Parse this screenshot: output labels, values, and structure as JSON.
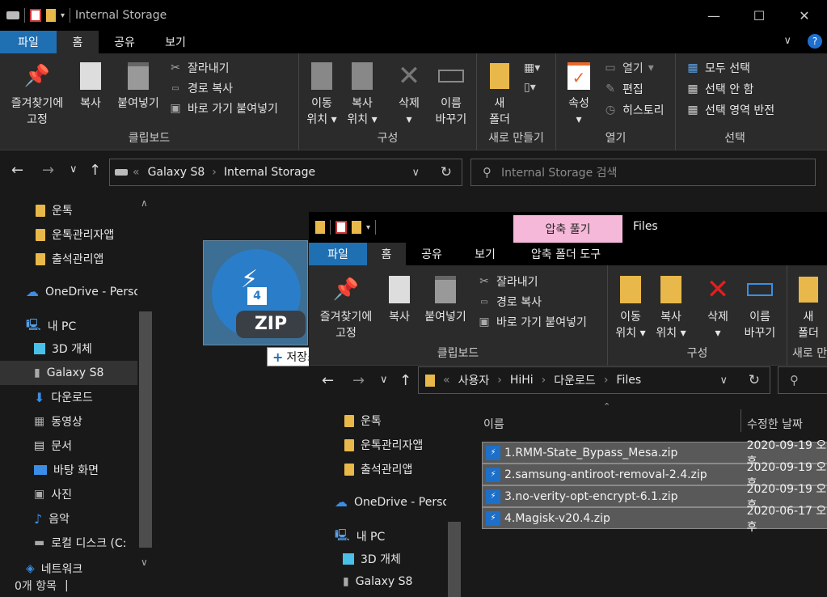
{
  "back_window": {
    "title": "Internal Storage",
    "tabs": [
      "파일",
      "홈",
      "공유",
      "보기"
    ],
    "ribbon": {
      "pin_label": [
        "즐겨찾기에",
        "고정"
      ],
      "copy": "복사",
      "paste": "붙여넣기",
      "cut": "잘라내기",
      "copy_path": "경로 복사",
      "paste_shortcut": "바로 가기 붙여넣기",
      "clipboard_group": "클립보드",
      "move_to": [
        "이동",
        "위치"
      ],
      "copy_to": [
        "복사",
        "위치"
      ],
      "delete": "삭제",
      "rename": [
        "이름",
        "바꾸기"
      ],
      "organize_group": "구성",
      "new_folder": [
        "새",
        "폴더"
      ],
      "new_group": "새로 만들기",
      "properties": "속성",
      "open": "열기",
      "edit": "편집",
      "history": "히스토리",
      "open_group": "열기",
      "select_all": "모두 선택",
      "select_none": "선택 안 함",
      "invert_selection": "선택 영역 반전",
      "select_group": "선택"
    },
    "address": [
      "Galaxy S8",
      "Internal Storage"
    ],
    "search_placeholder": "Internal Storage 검색",
    "nav_items": [
      "운톡",
      "운톡관리자앱",
      "출석관리앱",
      "OneDrive - Perso",
      "내 PC",
      "3D 개체",
      "Galaxy S8",
      "다운로드",
      "동영상",
      "문서",
      "바탕 화면",
      "사진",
      "음악",
      "로컬 디스크 (C:",
      "네트워크"
    ],
    "status": "0개 항목"
  },
  "drag": {
    "badge_text": "ZIP",
    "badge_num": "4",
    "tooltip": "저장소 루트(으)로 복사"
  },
  "front_window": {
    "context_tab": "압축 풀기",
    "title": "Files",
    "tabs": [
      "파일",
      "홈",
      "공유",
      "보기",
      "압축 폴더 도구"
    ],
    "ribbon": {
      "pin_label": [
        "즐겨찾기에",
        "고정"
      ],
      "copy": "복사",
      "paste": "붙여넣기",
      "cut": "잘라내기",
      "copy_path": "경로 복사",
      "paste_shortcut": "바로 가기 붙여넣기",
      "clipboard_group": "클립보드",
      "move_to": [
        "이동",
        "위치"
      ],
      "copy_to": [
        "복사",
        "위치"
      ],
      "delete": "삭제",
      "rename": [
        "이름",
        "바꾸기"
      ],
      "organize_group": "구성",
      "new_folder": [
        "새",
        "폴더"
      ],
      "new_group": "새로 만"
    },
    "address": [
      "사용자",
      "HiHi",
      "다운로드",
      "Files"
    ],
    "nav_items": [
      "운톡",
      "운톡관리자앱",
      "출석관리앱",
      "OneDrive - Perso",
      "내 PC",
      "3D 개체",
      "Galaxy S8"
    ],
    "columns": [
      "이름",
      "수정한 날짜"
    ],
    "files": [
      {
        "name": "1.RMM-State_Bypass_Mesa.zip",
        "date": "2020-09-19 오후"
      },
      {
        "name": "2.samsung-antiroot-removal-2.4.zip",
        "date": "2020-09-19 오후"
      },
      {
        "name": "3.no-verity-opt-encrypt-6.1.zip",
        "date": "2020-09-19 오후"
      },
      {
        "name": "4.Magisk-v20.4.zip",
        "date": "2020-06-17 오후"
      }
    ]
  },
  "colors": {
    "file_tab": "#1f6fb3",
    "context_tab": "#f5b8d9",
    "folder": "#e9b84a",
    "zip_icon": "#1e6fc8"
  }
}
